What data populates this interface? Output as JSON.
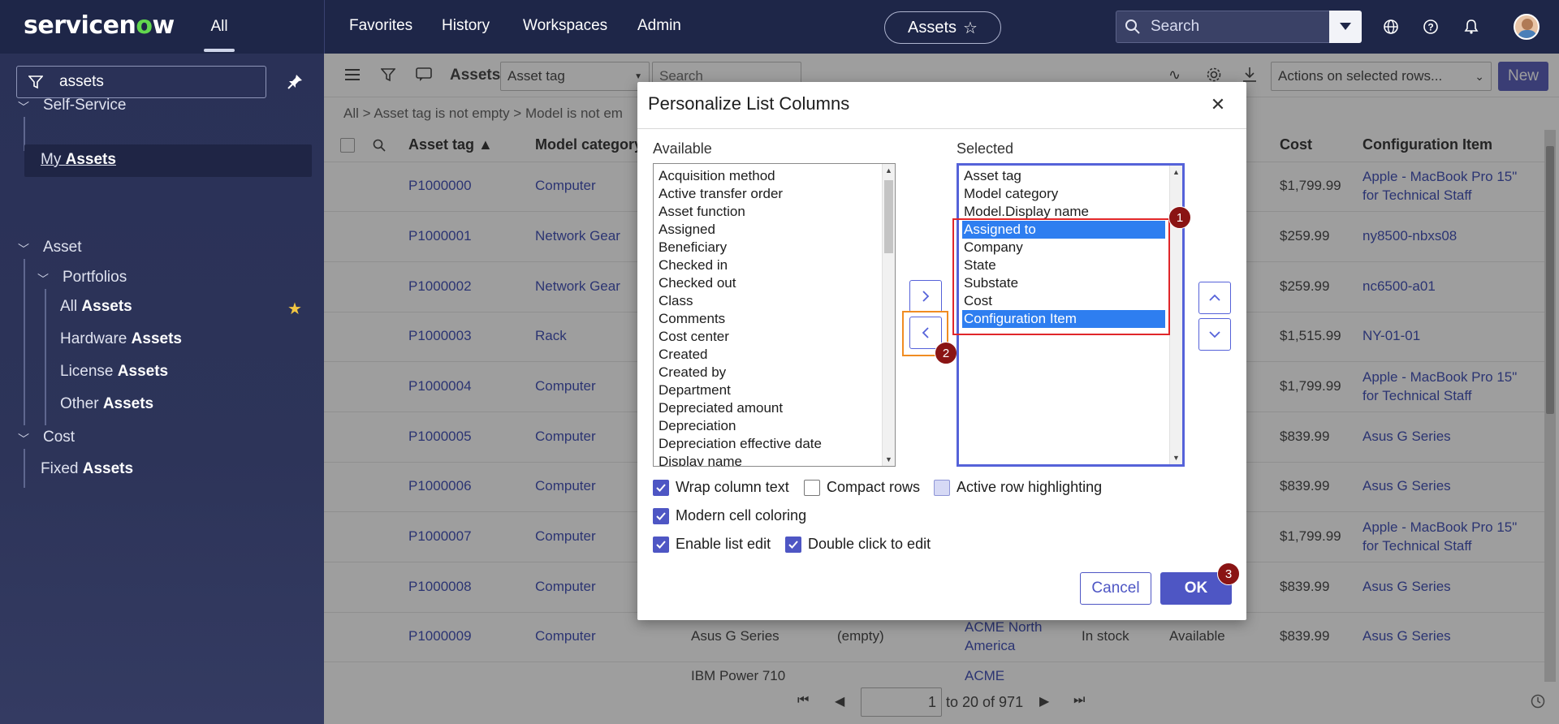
{
  "header": {
    "logo_text_before": "servicen",
    "logo_o": "o",
    "logo_text_after": "w",
    "all_tab": "All",
    "nav": [
      "Favorites",
      "History",
      "Workspaces",
      "Admin"
    ],
    "context_pill": "Assets",
    "search_placeholder": "Search",
    "icons": [
      "globe-icon",
      "help-icon",
      "bell-icon"
    ]
  },
  "sidebar": {
    "filter_value": "assets",
    "items": [
      {
        "label": "Self-Service",
        "prefix": "",
        "bold": ""
      },
      {
        "label": "",
        "prefix": "My ",
        "bold": "Assets"
      },
      {
        "label": "Asset",
        "prefix": "",
        "bold": ""
      },
      {
        "label": "Portfolios",
        "prefix": "",
        "bold": ""
      },
      {
        "label": "",
        "prefix": "All ",
        "bold": "Assets"
      },
      {
        "label": "",
        "prefix": "Hardware ",
        "bold": "Assets"
      },
      {
        "label": "",
        "prefix": "License ",
        "bold": "Assets"
      },
      {
        "label": "",
        "prefix": "Other ",
        "bold": "Assets"
      },
      {
        "label": "Cost",
        "prefix": "",
        "bold": ""
      },
      {
        "label": "",
        "prefix": "Fixed ",
        "bold": "Assets"
      }
    ]
  },
  "list": {
    "title": "Assets",
    "field_select": "Asset tag",
    "search_placeholder": "Search",
    "actions_select": "Actions on selected rows...",
    "new_button": "New",
    "breadcrumb": "All  >  Asset tag is not empty  >  Model is not em",
    "columns": [
      "Asset tag",
      "Model category",
      "Cost",
      "Configuration Item"
    ],
    "rows": [
      {
        "tag": "P1000000",
        "category": "Computer",
        "cost": "$1,799.99",
        "ci": "Apple - MacBook Pro 15\"",
        "ci2": "for Technical Staff"
      },
      {
        "tag": "P1000001",
        "category": "Network Gear",
        "cost": "$259.99",
        "ci": "ny8500-nbxs08",
        "ci2": ""
      },
      {
        "tag": "P1000002",
        "category": "Network Gear",
        "cost": "$259.99",
        "ci": "nc6500-a01",
        "ci2": ""
      },
      {
        "tag": "P1000003",
        "category": "Rack",
        "cost": "$1,515.99",
        "ci": "NY-01-01",
        "ci2": ""
      },
      {
        "tag": "P1000004",
        "category": "Computer",
        "cost": "$1,799.99",
        "ci": "Apple - MacBook Pro 15\"",
        "ci2": "for Technical Staff"
      },
      {
        "tag": "P1000005",
        "category": "Computer",
        "cost": "$839.99",
        "ci": "Asus G Series",
        "ci2": ""
      },
      {
        "tag": "P1000006",
        "category": "Computer",
        "cost": "$839.99",
        "ci": "Asus G Series",
        "ci2": ""
      },
      {
        "tag": "P1000007",
        "category": "Computer",
        "cost": "$1,799.99",
        "ci": "Apple - MacBook Pro 15\"",
        "ci2": "for Technical Staff"
      },
      {
        "tag": "P1000008",
        "category": "Computer",
        "cost": "$839.99",
        "ci": "Asus G Series",
        "ci2": ""
      },
      {
        "tag": "P1000009",
        "category": "Computer",
        "cost": "$839.99",
        "ci": "Asus G Series",
        "ci2": ""
      }
    ],
    "row9_extra": {
      "display_name": "Asus G Series",
      "assigned": "(empty)",
      "company": "ACME North",
      "company2": "America",
      "state": "In stock",
      "substate": "Available"
    },
    "row10_partial": {
      "display_name": "IBM Power 710",
      "company": "ACME"
    },
    "pager": {
      "page": "1",
      "range_text": "to 20 of 971"
    }
  },
  "modal": {
    "title": "Personalize List Columns",
    "available_label": "Available",
    "selected_label": "Selected",
    "available": [
      "Acquisition method",
      "Active transfer order",
      "Asset function",
      "Assigned",
      "Beneficiary",
      "Checked in",
      "Checked out",
      "Class",
      "Comments",
      "Cost center",
      "Created",
      "Created by",
      "Department",
      "Depreciated amount",
      "Depreciation",
      "Depreciation effective date",
      "Display name"
    ],
    "selected": [
      {
        "label": "Asset tag",
        "highlighted": false
      },
      {
        "label": "Model category",
        "highlighted": false
      },
      {
        "label": "Model.Display name",
        "highlighted": false
      },
      {
        "label": "Assigned to",
        "highlighted": true
      },
      {
        "label": "Company",
        "highlighted": false
      },
      {
        "label": "State",
        "highlighted": false
      },
      {
        "label": "Substate",
        "highlighted": false
      },
      {
        "label": "Cost",
        "highlighted": false
      },
      {
        "label": "Configuration Item",
        "highlighted": true
      }
    ],
    "options": [
      {
        "label": "Wrap column text",
        "checked": true
      },
      {
        "label": "Compact rows",
        "checked": false
      },
      {
        "label": "Active row highlighting",
        "checked": "partial"
      },
      {
        "label": "Modern cell coloring",
        "checked": true
      },
      {
        "label": "Enable list edit",
        "checked": true
      },
      {
        "label": "Double click to edit",
        "checked": true
      }
    ],
    "cancel_button": "Cancel",
    "ok_button": "OK"
  },
  "annotations": {
    "badge1": "1",
    "badge2": "2",
    "badge3": "3"
  },
  "colors": {
    "header_bg": "#1e2648",
    "accent": "#4e56c4",
    "selection": "#2e7ef0",
    "annotation_red": "#e0262a",
    "annotation_orange": "#f08c22",
    "badge": "#8a1414"
  }
}
